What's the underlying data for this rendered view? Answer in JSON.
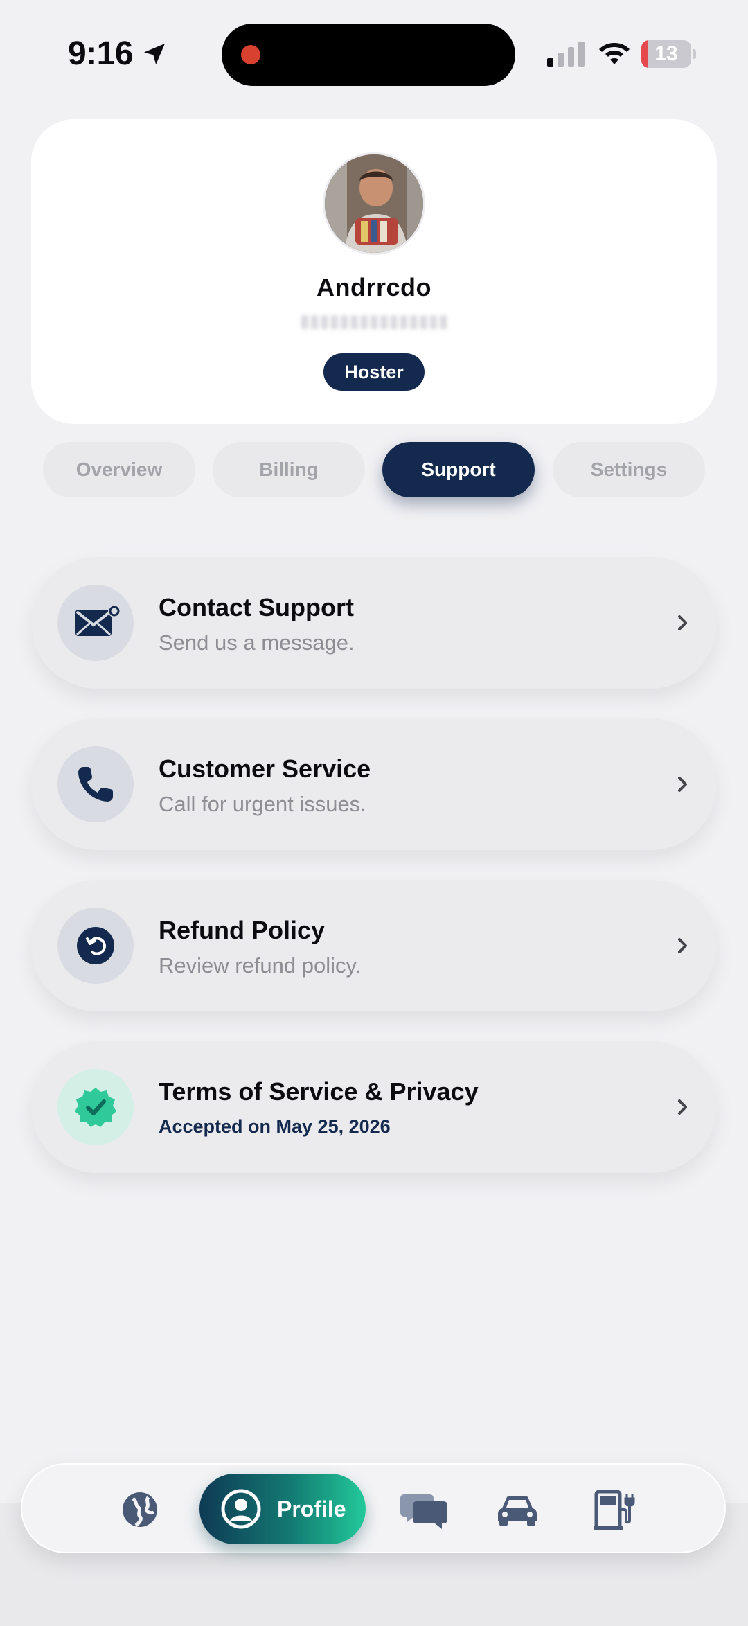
{
  "status_bar": {
    "time": "9:16",
    "battery_level": "13",
    "battery_color": "#e5484d",
    "recording_dot_color": "#d8402f"
  },
  "profile": {
    "name": "Andrrcdo",
    "role_badge": "Hoster"
  },
  "tabs": [
    {
      "label": "Overview",
      "active": false
    },
    {
      "label": "Billing",
      "active": false
    },
    {
      "label": "Support",
      "active": true
    },
    {
      "label": "Settings",
      "active": false
    }
  ],
  "support_items": [
    {
      "title": "Contact Support",
      "subtitle": "Send us a message.",
      "icon": "envelope-icon"
    },
    {
      "title": "Customer Service",
      "subtitle": "Call for urgent issues.",
      "icon": "phone-icon"
    },
    {
      "title": "Refund Policy",
      "subtitle": "Review refund policy.",
      "icon": "refund-icon"
    },
    {
      "title": "Terms of Service & Privacy",
      "subtitle": "Accepted on May 25, 2026",
      "icon": "verified-badge-icon"
    }
  ],
  "bottom_nav": {
    "items": [
      "globe-icon",
      "profile-icon",
      "chat-icon",
      "car-icon",
      "fuel-pump-icon"
    ],
    "active_label": "Profile"
  },
  "colors": {
    "accent_navy": "#13294d",
    "accent_teal": "#22c99a",
    "background": "#f1f1f4"
  }
}
